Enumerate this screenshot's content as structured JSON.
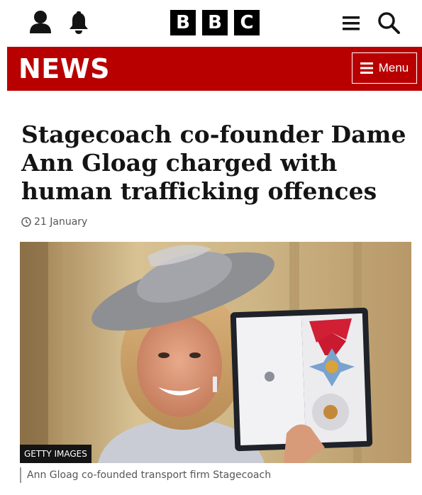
{
  "header": {
    "logo_letters": [
      "B",
      "B",
      "C"
    ],
    "icons": [
      "account-icon",
      "notifications-icon",
      "menu-icon",
      "search-icon"
    ]
  },
  "news_bar": {
    "title": "NEWS",
    "menu_label": "Menu",
    "color": "#b80000"
  },
  "article": {
    "headline": "Stagecoach co-founder Dame Ann Gloag charged with human trafficking offences",
    "date": "21 January",
    "image_credit": "GETTY IMAGES",
    "caption": "Ann Gloag co-founded transport firm Stagecoach"
  }
}
